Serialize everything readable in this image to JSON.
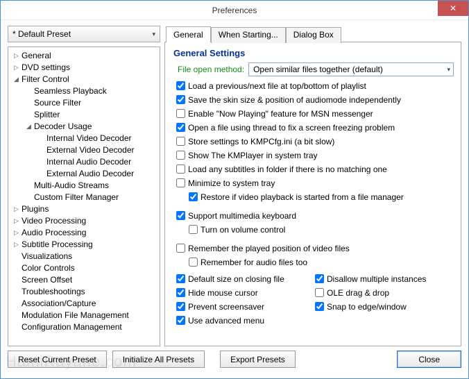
{
  "window": {
    "title": "Preferences",
    "close_glyph": "✕"
  },
  "preset": {
    "selected": "* Default Preset"
  },
  "tree": [
    {
      "label": "General",
      "depth": 0,
      "tw": "▷"
    },
    {
      "label": "DVD settings",
      "depth": 0,
      "tw": "▷"
    },
    {
      "label": "Filter Control",
      "depth": 0,
      "tw": "◢"
    },
    {
      "label": "Seamless Playback",
      "depth": 1,
      "tw": ""
    },
    {
      "label": "Source Filter",
      "depth": 1,
      "tw": ""
    },
    {
      "label": "Splitter",
      "depth": 1,
      "tw": ""
    },
    {
      "label": "Decoder Usage",
      "depth": 1,
      "tw": "◢"
    },
    {
      "label": "Internal Video Decoder",
      "depth": 2,
      "tw": ""
    },
    {
      "label": "External Video Decoder",
      "depth": 2,
      "tw": ""
    },
    {
      "label": "Internal Audio Decoder",
      "depth": 2,
      "tw": ""
    },
    {
      "label": "External Audio Decoder",
      "depth": 2,
      "tw": ""
    },
    {
      "label": "Multi-Audio Streams",
      "depth": 1,
      "tw": ""
    },
    {
      "label": "Custom Filter Manager",
      "depth": 1,
      "tw": ""
    },
    {
      "label": "Plugins",
      "depth": 0,
      "tw": "▷"
    },
    {
      "label": "Video Processing",
      "depth": 0,
      "tw": "▷"
    },
    {
      "label": "Audio Processing",
      "depth": 0,
      "tw": "▷"
    },
    {
      "label": "Subtitle Processing",
      "depth": 0,
      "tw": "▷"
    },
    {
      "label": "Visualizations",
      "depth": 0,
      "tw": ""
    },
    {
      "label": "Color Controls",
      "depth": 0,
      "tw": ""
    },
    {
      "label": "Screen Offset",
      "depth": 0,
      "tw": ""
    },
    {
      "label": "Troubleshootings",
      "depth": 0,
      "tw": ""
    },
    {
      "label": "Association/Capture",
      "depth": 0,
      "tw": ""
    },
    {
      "label": "Modulation File Management",
      "depth": 0,
      "tw": ""
    },
    {
      "label": "Configuration Management",
      "depth": 0,
      "tw": ""
    }
  ],
  "tabs": {
    "t0": "General",
    "t1": "When Starting...",
    "t2": "Dialog Box"
  },
  "panel": {
    "heading": "General Settings",
    "file_open_label": "File open method:",
    "file_open_value": "Open similar files together (default)",
    "checks": {
      "c0": "Load a previous/next file at top/bottom of playlist",
      "c1": "Save the skin size & position of audiomode independently",
      "c2": "Enable \"Now Playing\" feature for MSN messenger",
      "c3": "Open a file using thread to fix a screen freezing problem",
      "c4": "Store settings to KMPCfg.ini (a bit slow)",
      "c5": "Show The KMPlayer in system tray",
      "c6": "Load any subtitles in folder if there is no matching one",
      "c7": "Minimize to system tray",
      "c7a": "Restore if video playback is started from a file manager",
      "c8": "Support multimedia keyboard",
      "c8a": "Turn on volume control",
      "c9": "Remember the played position of video files",
      "c9a": "Remember for audio files too",
      "l0": "Default size on closing file",
      "l1": "Hide mouse cursor",
      "l2": "Prevent screensaver",
      "l3": "Use advanced menu",
      "r0": "Disallow multiple instances",
      "r1": "OLE drag & drop",
      "r2": "Snap to edge/window"
    },
    "states": {
      "c0": true,
      "c1": true,
      "c2": false,
      "c3": true,
      "c4": false,
      "c5": false,
      "c6": false,
      "c7": false,
      "c7a": true,
      "c8": true,
      "c8a": false,
      "c9": false,
      "c9a": false,
      "l0": true,
      "l1": true,
      "l2": true,
      "l3": true,
      "r0": true,
      "r1": false,
      "r2": true
    }
  },
  "footer": {
    "reset": "Reset Current Preset",
    "init": "Initialize All Presets",
    "export": "Export Presets",
    "close": "Close"
  },
  "watermark": "HamiRayane.com"
}
